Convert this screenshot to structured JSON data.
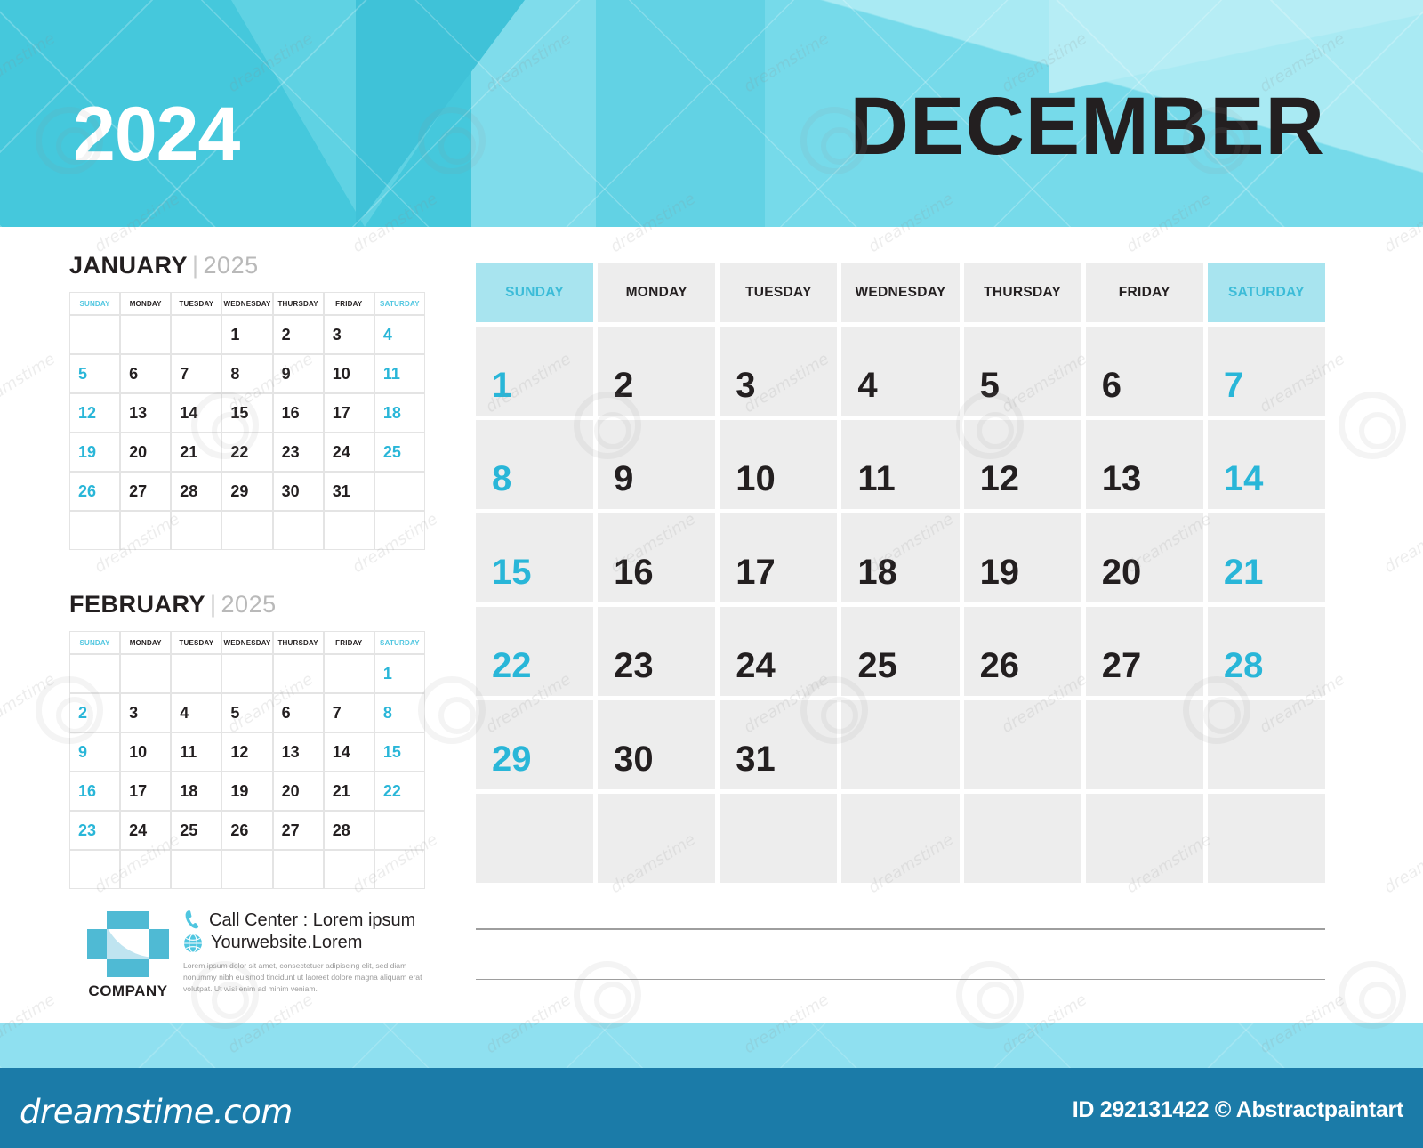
{
  "header": {
    "year": "2024",
    "month": "DECEMBER",
    "bg_color": "#45C8DC",
    "accent_light": "#8FE2EE",
    "month_text_color": "#231F20"
  },
  "theme": {
    "cyan": "#29B6D8",
    "cyan_light": "#A8E4EF",
    "cell_gray": "#EDEDED",
    "watermark_bar": "#1B7BA8"
  },
  "main_calendar": {
    "weekday_headers": [
      {
        "label": "SUNDAY",
        "weekend": true
      },
      {
        "label": "MONDAY",
        "weekend": false
      },
      {
        "label": "TUESDAY",
        "weekend": false
      },
      {
        "label": "WEDNESDAY",
        "weekend": false
      },
      {
        "label": "THURSDAY",
        "weekend": false
      },
      {
        "label": "FRIDAY",
        "weekend": false
      },
      {
        "label": "SATURDAY",
        "weekend": true
      }
    ],
    "weeks": [
      [
        "1",
        "2",
        "3",
        "4",
        "5",
        "6",
        "7"
      ],
      [
        "8",
        "9",
        "10",
        "11",
        "12",
        "13",
        "14"
      ],
      [
        "15",
        "16",
        "17",
        "18",
        "19",
        "20",
        "21"
      ],
      [
        "22",
        "23",
        "24",
        "25",
        "26",
        "27",
        "28"
      ],
      [
        "29",
        "30",
        "31",
        "",
        "",
        "",
        ""
      ],
      [
        "",
        "",
        "",
        "",
        "",
        "",
        ""
      ]
    ]
  },
  "mini_calendars": [
    {
      "month": "JANUARY",
      "separator": "|",
      "year": "2025",
      "weekday_headers": [
        "SUNDAY",
        "MONDAY",
        "TUESDAY",
        "WEDNESDAY",
        "THURSDAY",
        "FRIDAY",
        "SATURDAY"
      ],
      "weeks": [
        [
          "",
          "",
          "",
          "1",
          "2",
          "3",
          "4"
        ],
        [
          "5",
          "6",
          "7",
          "8",
          "9",
          "10",
          "11"
        ],
        [
          "12",
          "13",
          "14",
          "15",
          "16",
          "17",
          "18"
        ],
        [
          "19",
          "20",
          "21",
          "22",
          "23",
          "24",
          "25"
        ],
        [
          "26",
          "27",
          "28",
          "29",
          "30",
          "31",
          ""
        ],
        [
          "",
          "",
          "",
          "",
          "",
          "",
          ""
        ]
      ]
    },
    {
      "month": "FEBRUARY",
      "separator": "|",
      "year": "2025",
      "weekday_headers": [
        "SUNDAY",
        "MONDAY",
        "TUESDAY",
        "WEDNESDAY",
        "THURSDAY",
        "FRIDAY",
        "SATURDAY"
      ],
      "weeks": [
        [
          "",
          "",
          "",
          "",
          "",
          "",
          "1"
        ],
        [
          "2",
          "3",
          "4",
          "5",
          "6",
          "7",
          "8"
        ],
        [
          "9",
          "10",
          "11",
          "12",
          "13",
          "14",
          "15"
        ],
        [
          "16",
          "17",
          "18",
          "19",
          "20",
          "21",
          "22"
        ],
        [
          "23",
          "24",
          "25",
          "26",
          "27",
          "28",
          ""
        ],
        [
          "",
          "",
          "",
          "",
          "",
          "",
          ""
        ]
      ]
    }
  ],
  "company": {
    "name": "COMPANY",
    "call_center": "Call Center : Lorem ipsum",
    "website": "Yourwebsite.Lorem",
    "lorem": "Lorem ipsum dolor sit amet, consectetuer adipiscing elit, sed diam nonummy nibh euismod tincidunt ut laoreet dolore magna aliquam erat volutpat. Ut wisi enim ad minim veniam."
  },
  "watermark": {
    "site": "dreamstime.com",
    "credit": "ID 292131422 © Abstractpaintart",
    "tile_text": "dreamstime"
  }
}
